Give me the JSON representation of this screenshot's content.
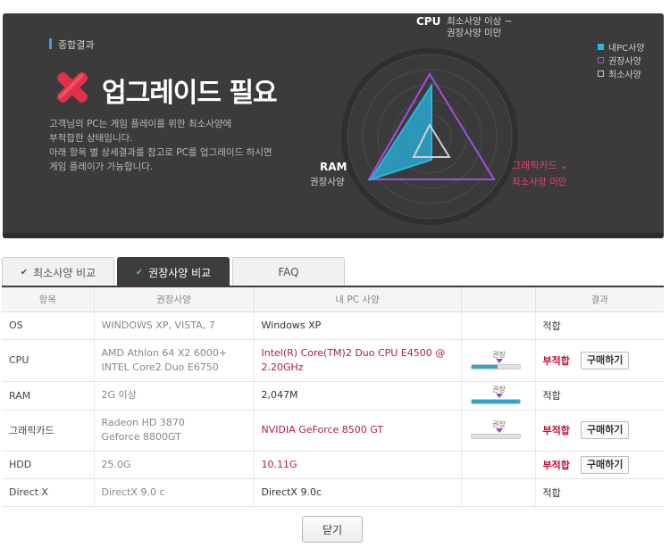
{
  "summary": {
    "section_label": "종합결과",
    "title": "업그레이드 필요",
    "desc_lines": [
      "고객님의 PC는 게임 플레이를 위한 최소사양에",
      "부적합한 상태입니다.",
      "아래 항목 별 상세결과를 참고로 PC를 업그레이드 하시면",
      "게임 플레이가 가능합니다."
    ]
  },
  "radar": {
    "cpu_label": "CPU",
    "cpu_note_1": "최소사양 이상 ~",
    "cpu_note_2": "권장사양 미만",
    "ram_label": "RAM",
    "ram_note": "권장사양",
    "gpu_label": "그래픽카드",
    "gpu_note": "최소사양 미만",
    "legend": [
      {
        "label": "내PC사양",
        "color": "#2ab4e0"
      },
      {
        "label": "권장사양",
        "color": "#a24fe0"
      },
      {
        "label": "최소사양",
        "color": "#c8c8c8"
      }
    ]
  },
  "tabs": [
    {
      "label": "최소사양 비교"
    },
    {
      "label": "권장사양 비교"
    },
    {
      "label": "FAQ"
    }
  ],
  "table": {
    "headers": [
      "항목",
      "권장사양",
      "내 PC 사양",
      "",
      "결과"
    ],
    "meter_tag": "권장",
    "buy_label": "구매하기",
    "rows": [
      {
        "item": "OS",
        "req": "WINDOWS XP, VISTA, 7",
        "mine": "Windows XP",
        "result": "적합"
      },
      {
        "item": "CPU",
        "req1": "AMD Athlon 64 X2 6000+",
        "req2": "INTEL Core2 Duo E6750",
        "mine1": "Intel(R) Core(TM)2 Duo CPU E4500 @",
        "mine2": "2.20GHz",
        "result": "부적합",
        "level": 0.55
      },
      {
        "item": "RAM",
        "req": "2G 이상",
        "mine": "2,047M",
        "result": "적합",
        "level": 1.0
      },
      {
        "item": "그래픽카드",
        "req1": "Radeon HD 3870",
        "req2": "Geforce 8800GT",
        "mine": "NVIDIA GeForce 8500 GT",
        "result": "부적합",
        "level": 0.0
      },
      {
        "item": "HDD",
        "req": "25.0G",
        "mine": "10.11G",
        "result": "부적합"
      },
      {
        "item": "Direct X",
        "req": "DirectX 9.0 c",
        "mine": "DirectX 9.0c",
        "result": "적합"
      }
    ]
  },
  "close_label": "닫기"
}
